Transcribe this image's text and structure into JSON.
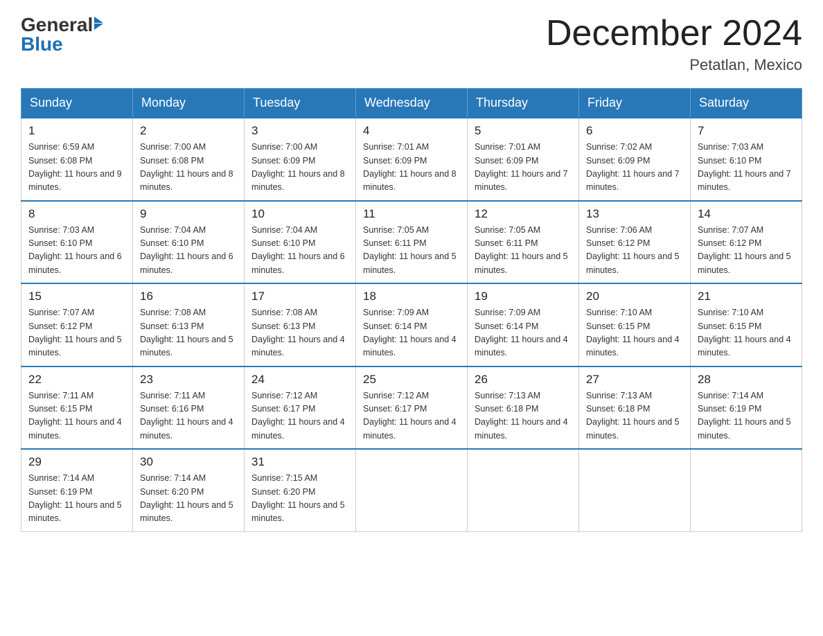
{
  "header": {
    "logo_text_general": "General",
    "logo_text_blue": "Blue",
    "month_title": "December 2024",
    "location": "Petatlan, Mexico"
  },
  "days_of_week": [
    "Sunday",
    "Monday",
    "Tuesday",
    "Wednesday",
    "Thursday",
    "Friday",
    "Saturday"
  ],
  "weeks": [
    [
      {
        "day": "1",
        "sunrise": "6:59 AM",
        "sunset": "6:08 PM",
        "daylight": "11 hours and 9 minutes."
      },
      {
        "day": "2",
        "sunrise": "7:00 AM",
        "sunset": "6:08 PM",
        "daylight": "11 hours and 8 minutes."
      },
      {
        "day": "3",
        "sunrise": "7:00 AM",
        "sunset": "6:09 PM",
        "daylight": "11 hours and 8 minutes."
      },
      {
        "day": "4",
        "sunrise": "7:01 AM",
        "sunset": "6:09 PM",
        "daylight": "11 hours and 8 minutes."
      },
      {
        "day": "5",
        "sunrise": "7:01 AM",
        "sunset": "6:09 PM",
        "daylight": "11 hours and 7 minutes."
      },
      {
        "day": "6",
        "sunrise": "7:02 AM",
        "sunset": "6:09 PM",
        "daylight": "11 hours and 7 minutes."
      },
      {
        "day": "7",
        "sunrise": "7:03 AM",
        "sunset": "6:10 PM",
        "daylight": "11 hours and 7 minutes."
      }
    ],
    [
      {
        "day": "8",
        "sunrise": "7:03 AM",
        "sunset": "6:10 PM",
        "daylight": "11 hours and 6 minutes."
      },
      {
        "day": "9",
        "sunrise": "7:04 AM",
        "sunset": "6:10 PM",
        "daylight": "11 hours and 6 minutes."
      },
      {
        "day": "10",
        "sunrise": "7:04 AM",
        "sunset": "6:10 PM",
        "daylight": "11 hours and 6 minutes."
      },
      {
        "day": "11",
        "sunrise": "7:05 AM",
        "sunset": "6:11 PM",
        "daylight": "11 hours and 5 minutes."
      },
      {
        "day": "12",
        "sunrise": "7:05 AM",
        "sunset": "6:11 PM",
        "daylight": "11 hours and 5 minutes."
      },
      {
        "day": "13",
        "sunrise": "7:06 AM",
        "sunset": "6:12 PM",
        "daylight": "11 hours and 5 minutes."
      },
      {
        "day": "14",
        "sunrise": "7:07 AM",
        "sunset": "6:12 PM",
        "daylight": "11 hours and 5 minutes."
      }
    ],
    [
      {
        "day": "15",
        "sunrise": "7:07 AM",
        "sunset": "6:12 PM",
        "daylight": "11 hours and 5 minutes."
      },
      {
        "day": "16",
        "sunrise": "7:08 AM",
        "sunset": "6:13 PM",
        "daylight": "11 hours and 5 minutes."
      },
      {
        "day": "17",
        "sunrise": "7:08 AM",
        "sunset": "6:13 PM",
        "daylight": "11 hours and 4 minutes."
      },
      {
        "day": "18",
        "sunrise": "7:09 AM",
        "sunset": "6:14 PM",
        "daylight": "11 hours and 4 minutes."
      },
      {
        "day": "19",
        "sunrise": "7:09 AM",
        "sunset": "6:14 PM",
        "daylight": "11 hours and 4 minutes."
      },
      {
        "day": "20",
        "sunrise": "7:10 AM",
        "sunset": "6:15 PM",
        "daylight": "11 hours and 4 minutes."
      },
      {
        "day": "21",
        "sunrise": "7:10 AM",
        "sunset": "6:15 PM",
        "daylight": "11 hours and 4 minutes."
      }
    ],
    [
      {
        "day": "22",
        "sunrise": "7:11 AM",
        "sunset": "6:15 PM",
        "daylight": "11 hours and 4 minutes."
      },
      {
        "day": "23",
        "sunrise": "7:11 AM",
        "sunset": "6:16 PM",
        "daylight": "11 hours and 4 minutes."
      },
      {
        "day": "24",
        "sunrise": "7:12 AM",
        "sunset": "6:17 PM",
        "daylight": "11 hours and 4 minutes."
      },
      {
        "day": "25",
        "sunrise": "7:12 AM",
        "sunset": "6:17 PM",
        "daylight": "11 hours and 4 minutes."
      },
      {
        "day": "26",
        "sunrise": "7:13 AM",
        "sunset": "6:18 PM",
        "daylight": "11 hours and 4 minutes."
      },
      {
        "day": "27",
        "sunrise": "7:13 AM",
        "sunset": "6:18 PM",
        "daylight": "11 hours and 5 minutes."
      },
      {
        "day": "28",
        "sunrise": "7:14 AM",
        "sunset": "6:19 PM",
        "daylight": "11 hours and 5 minutes."
      }
    ],
    [
      {
        "day": "29",
        "sunrise": "7:14 AM",
        "sunset": "6:19 PM",
        "daylight": "11 hours and 5 minutes."
      },
      {
        "day": "30",
        "sunrise": "7:14 AM",
        "sunset": "6:20 PM",
        "daylight": "11 hours and 5 minutes."
      },
      {
        "day": "31",
        "sunrise": "7:15 AM",
        "sunset": "6:20 PM",
        "daylight": "11 hours and 5 minutes."
      },
      null,
      null,
      null,
      null
    ]
  ]
}
